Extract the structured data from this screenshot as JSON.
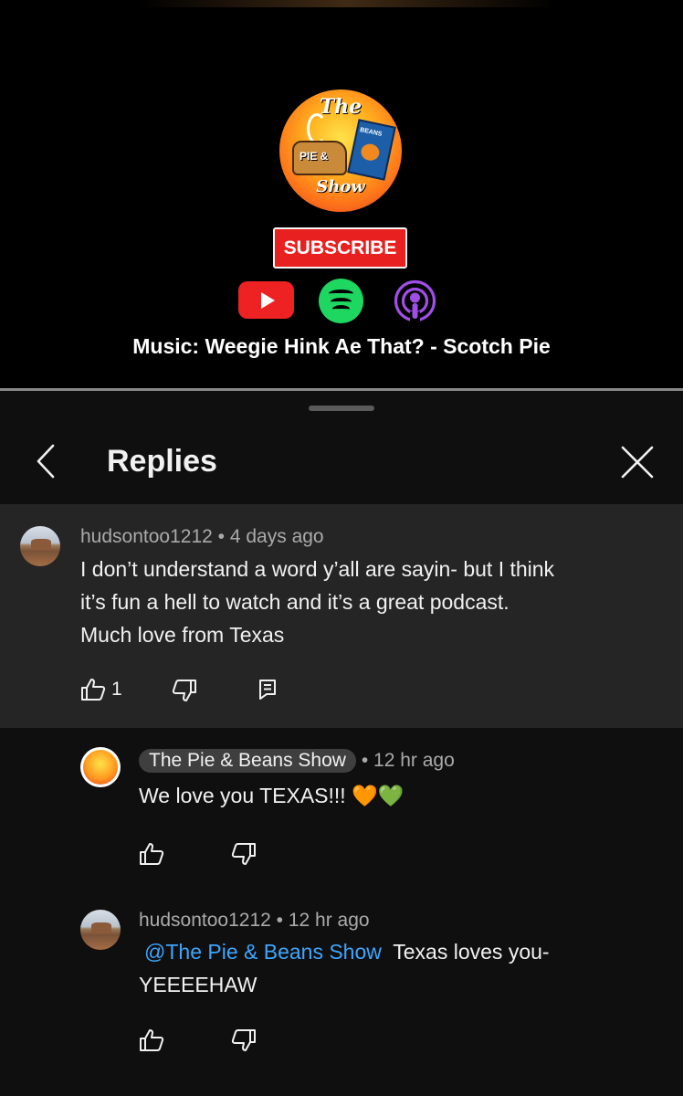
{
  "video": {
    "logo_text_top": "The",
    "logo_text_bottom": "Show",
    "logo_pie_text": "PIE &",
    "logo_can_text": "BEANS",
    "subscribe_label": "SUBSCRIBE",
    "music_text": "Music: Weegie Hink Ae That? - Scotch Pie",
    "platform_icons": [
      "youtube-icon",
      "spotify-icon",
      "podcasts-icon"
    ]
  },
  "sheet": {
    "title": "Replies",
    "back_icon": "chevron-left-icon",
    "close_icon": "close-icon"
  },
  "parent_comment": {
    "author": "hudsontoo1212",
    "separator": "•",
    "time": "4 days ago",
    "text_line1": "I don’t understand a word y’all are sayin- but I think",
    "text_line2": "it’s fun a hell to watch and it’s a great podcast.",
    "text_line3": "Much love from Texas",
    "like_count": "1"
  },
  "replies": [
    {
      "author": "The Pie & Beans Show",
      "separator": "•",
      "time": "12 hr ago",
      "text": "We love you TEXAS!!! 🧡💚"
    },
    {
      "author": "hudsontoo1212",
      "separator": "•",
      "time": "12 hr ago",
      "mention": "@The Pie & Beans Show",
      "text_rest": "Texas loves you-",
      "text_line2": "YEEEEHAW"
    }
  ],
  "colors": {
    "background": "#0f0f0f",
    "parent_highlight": "#252525",
    "mention_blue": "#3ea6ff",
    "subscribe_red": "#e82020",
    "spotify_green": "#1ed760",
    "podcasts_purple": "#9b3ed8"
  }
}
